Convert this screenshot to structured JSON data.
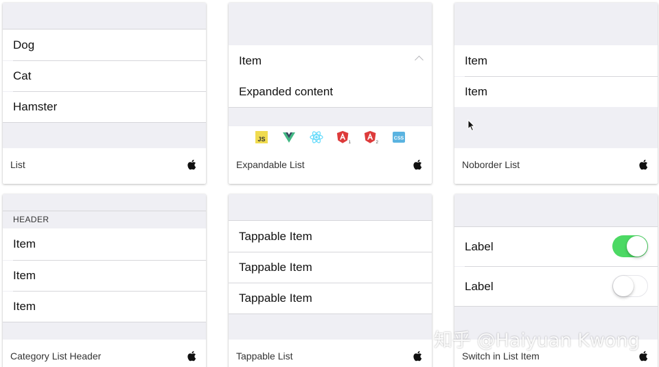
{
  "cards": {
    "list": {
      "items": [
        "Dog",
        "Cat",
        "Hamster"
      ],
      "caption": "List",
      "platform_icon": "apple-icon"
    },
    "expandable": {
      "item": "Item",
      "content": "Expanded content",
      "caption": "Expandable List",
      "platform_icon": "apple-icon",
      "tech_icons": [
        "javascript-icon",
        "vue-icon",
        "react-icon",
        "angular-1-icon",
        "angular-2-icon",
        "css-icon"
      ],
      "tech_labels": {
        "js": "JS",
        "a1": "1",
        "a2": "2",
        "css": "CSS"
      }
    },
    "noborder": {
      "items": [
        "Item",
        "Item"
      ],
      "caption": "Noborder List",
      "platform_icon": "apple-icon"
    },
    "category": {
      "header": "HEADER",
      "items": [
        "Item",
        "Item",
        "Item"
      ],
      "caption": "Category List Header",
      "platform_icon": "apple-icon"
    },
    "tappable": {
      "items": [
        "Tappable Item",
        "Tappable Item",
        "Tappable Item"
      ],
      "caption": "Tappable List",
      "platform_icon": "apple-icon"
    },
    "switch": {
      "items": [
        {
          "label": "Label",
          "on": true
        },
        {
          "label": "Label",
          "on": false
        }
      ],
      "caption": "Switch in List Item",
      "platform_icon": "apple-icon"
    }
  },
  "watermark": "知乎 @Haiyuan Kwong",
  "colors": {
    "toggle_on": "#4cd964",
    "background_gray": "#efeff4",
    "separator": "#d6d6da"
  }
}
